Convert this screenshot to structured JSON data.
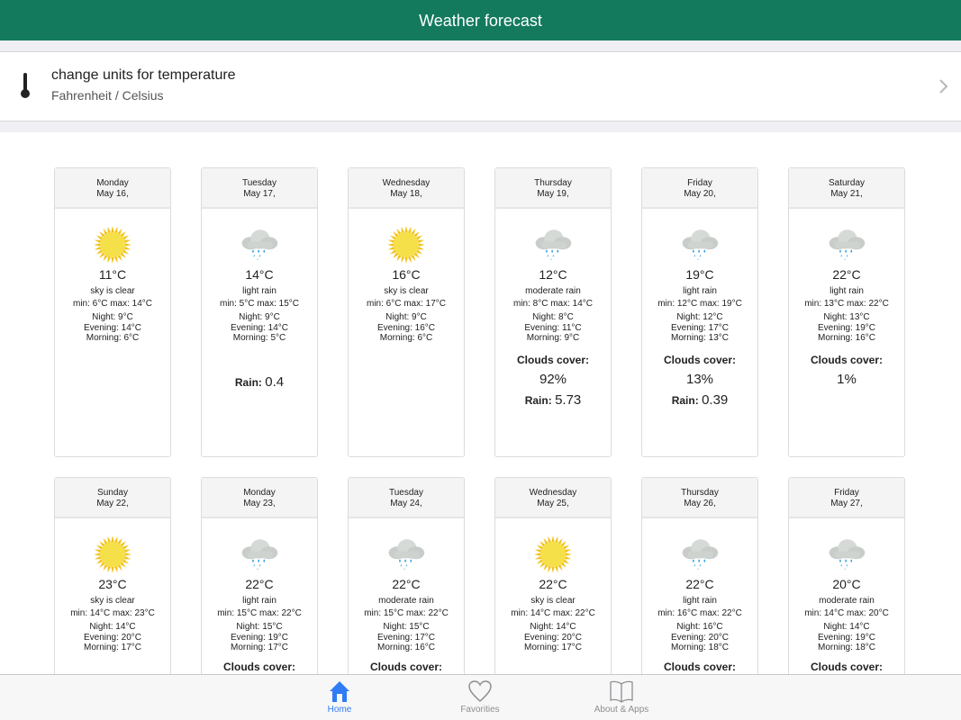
{
  "header": {
    "title": "Weather forecast"
  },
  "settings": {
    "title": "change units for temperature",
    "subtitle": "Fahrenheit / Celsius"
  },
  "labels": {
    "clouds": "Clouds cover:",
    "rain": "Rain:"
  },
  "days": [
    {
      "day": "Monday",
      "date": "May 16,",
      "icon": "sun",
      "temp": "11°C",
      "desc": "sky is clear",
      "minmax": "min: 6°C max: 14°C",
      "night": "Night: 9°C",
      "evening": "Evening: 14°C",
      "morning": "Morning: 6°C"
    },
    {
      "day": "Tuesday",
      "date": "May 17,",
      "icon": "rain",
      "temp": "14°C",
      "desc": "light rain",
      "minmax": "min: 5°C max: 15°C",
      "night": "Night: 9°C",
      "evening": "Evening: 14°C",
      "morning": "Morning: 5°C",
      "rain": "0.4"
    },
    {
      "day": "Wednesday",
      "date": "May 18,",
      "icon": "sun",
      "temp": "16°C",
      "desc": "sky is clear",
      "minmax": "min: 6°C max: 17°C",
      "night": "Night: 9°C",
      "evening": "Evening: 16°C",
      "morning": "Morning: 6°C"
    },
    {
      "day": "Thursday",
      "date": "May 19,",
      "icon": "rain",
      "temp": "12°C",
      "desc": "moderate rain",
      "minmax": "min: 8°C max: 14°C",
      "night": "Night: 8°C",
      "evening": "Evening: 11°C",
      "morning": "Morning: 9°C",
      "clouds": "92%",
      "rain": "5.73"
    },
    {
      "day": "Friday",
      "date": "May 20,",
      "icon": "rain",
      "temp": "19°C",
      "desc": "light rain",
      "minmax": "min: 12°C max: 19°C",
      "night": "Night: 12°C",
      "evening": "Evening: 17°C",
      "morning": "Morning: 13°C",
      "clouds": "13%",
      "rain": "0.39"
    },
    {
      "day": "Saturday",
      "date": "May 21,",
      "icon": "rain",
      "temp": "22°C",
      "desc": "light rain",
      "minmax": "min: 13°C max: 22°C",
      "night": "Night: 13°C",
      "evening": "Evening: 19°C",
      "morning": "Morning: 16°C",
      "clouds": "1%"
    },
    {
      "day": "Sunday",
      "date": "May 22,",
      "icon": "sun",
      "temp": "23°C",
      "desc": "sky is clear",
      "minmax": "min: 14°C max: 23°C",
      "night": "Night: 14°C",
      "evening": "Evening: 20°C",
      "morning": "Morning: 17°C"
    },
    {
      "day": "Monday",
      "date": "May 23,",
      "icon": "rain",
      "temp": "22°C",
      "desc": "light rain",
      "minmax": "min: 15°C max: 22°C",
      "night": "Night: 15°C",
      "evening": "Evening: 19°C",
      "morning": "Morning: 17°C",
      "cloudsLabelOnly": true
    },
    {
      "day": "Tuesday",
      "date": "May 24,",
      "icon": "rain",
      "temp": "22°C",
      "desc": "moderate rain",
      "minmax": "min: 15°C max: 22°C",
      "night": "Night: 15°C",
      "evening": "Evening: 17°C",
      "morning": "Morning: 16°C",
      "cloudsLabelOnly": true
    },
    {
      "day": "Wednesday",
      "date": "May 25,",
      "icon": "sun",
      "temp": "22°C",
      "desc": "sky is clear",
      "minmax": "min: 14°C max: 22°C",
      "night": "Night: 14°C",
      "evening": "Evening: 20°C",
      "morning": "Morning: 17°C"
    },
    {
      "day": "Thursday",
      "date": "May 26,",
      "icon": "rain",
      "temp": "22°C",
      "desc": "light rain",
      "minmax": "min: 16°C max: 22°C",
      "night": "Night: 16°C",
      "evening": "Evening: 20°C",
      "morning": "Morning: 18°C",
      "cloudsLabelOnly": true
    },
    {
      "day": "Friday",
      "date": "May 27,",
      "icon": "rain",
      "temp": "20°C",
      "desc": "moderate rain",
      "minmax": "min: 14°C max: 20°C",
      "night": "Night: 14°C",
      "evening": "Evening: 19°C",
      "morning": "Morning: 18°C",
      "cloudsLabelOnly": true
    }
  ],
  "tabs": [
    {
      "label": "Home",
      "icon": "home-icon",
      "active": true
    },
    {
      "label": "Favorities",
      "icon": "heart-icon"
    },
    {
      "label": "About & Apps",
      "icon": "book-icon"
    }
  ],
  "colors": {
    "header": "#137a5e",
    "active_tab": "#2f7cf6"
  }
}
